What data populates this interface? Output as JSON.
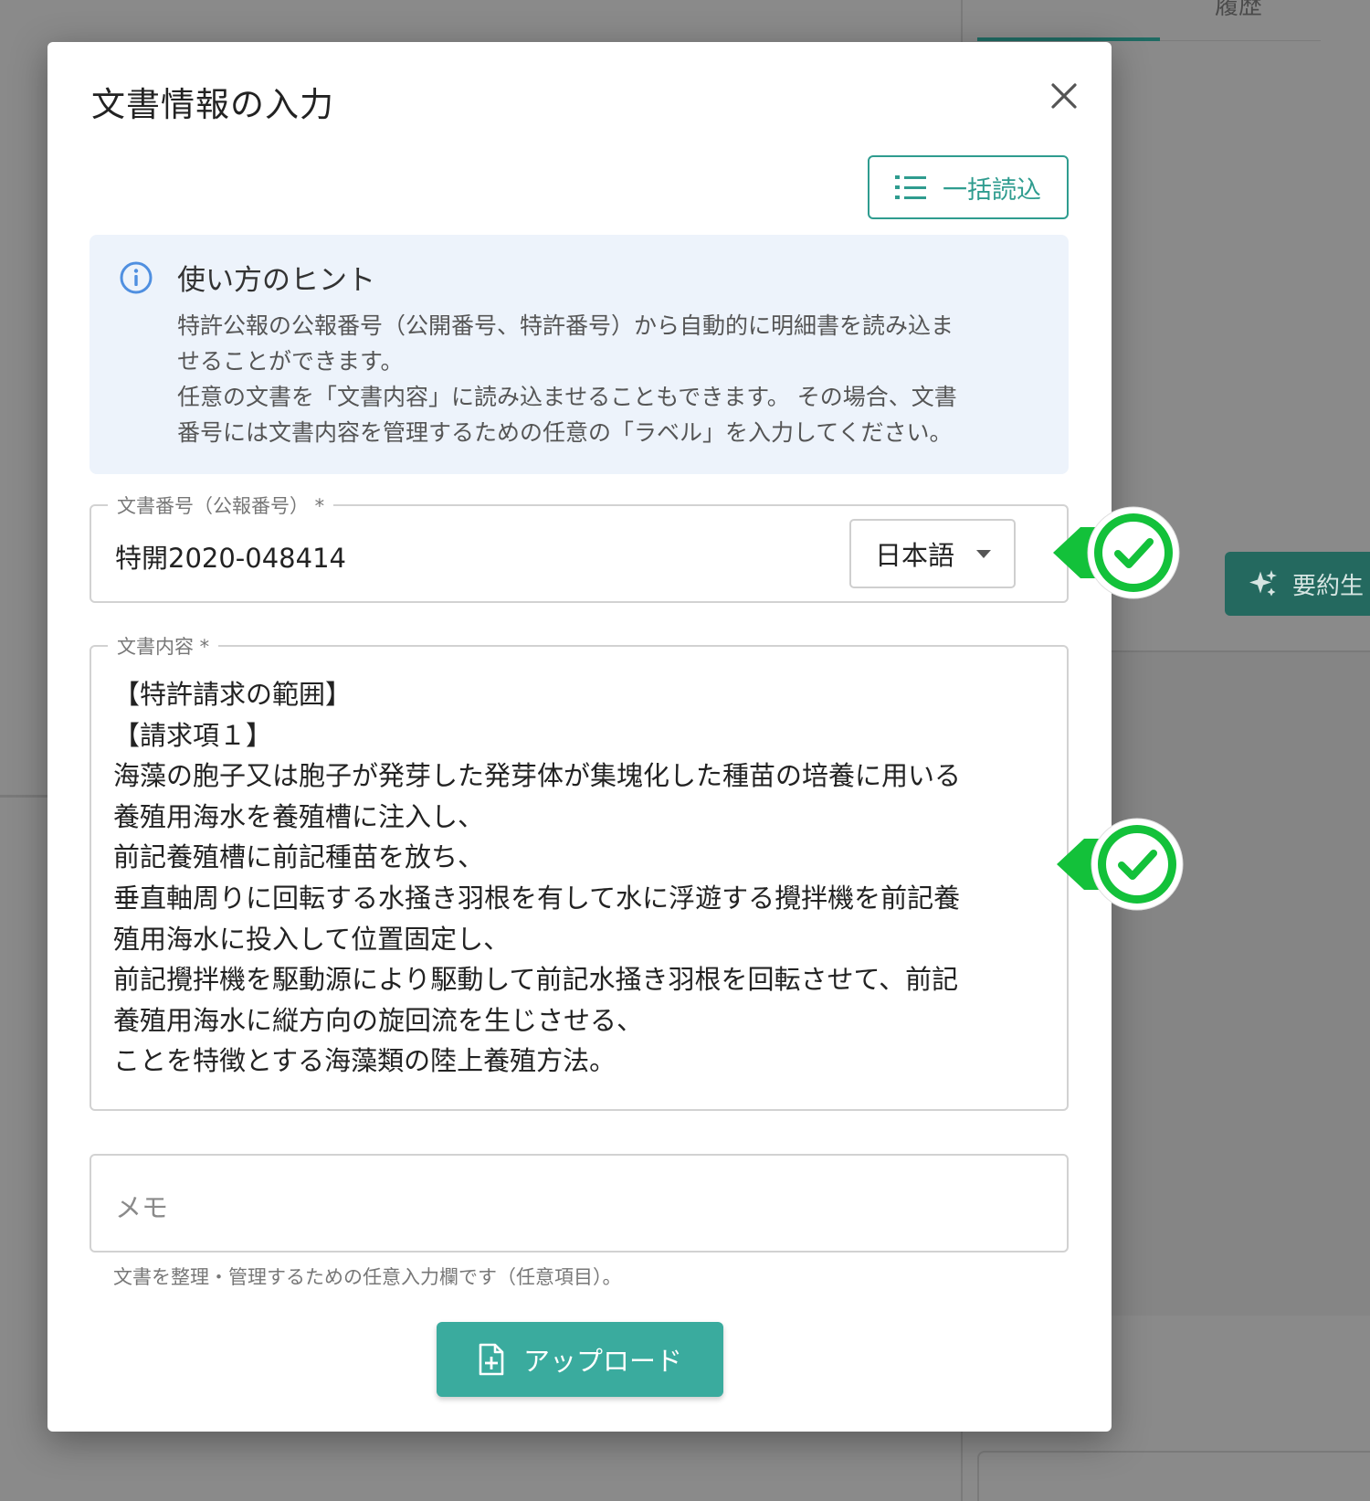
{
  "background": {
    "right_tab_label": "履歴",
    "summary_button_label": "要約生"
  },
  "modal": {
    "title": "文書情報の入力",
    "bulk_button_label": "一括読込",
    "hint": {
      "title": "使い方のヒント",
      "lines": [
        "特許公報の公報番号（公開番号、特許番号）から自動的に明細書を読み込ま",
        "せることができます。",
        "任意の文書を「文書内容」に読み込ませることもできます。 その場合、文書",
        "番号には文書内容を管理するための任意の「ラベル」を入力してください。"
      ]
    },
    "doc_number": {
      "label": "文書番号（公報番号） *",
      "value": "特開2020-048414",
      "language": "日本語"
    },
    "doc_content": {
      "label": "文書内容 *",
      "value": "【特許請求の範囲】\n【請求項１】\n海藻の胞子又は胞子が発芽した発芽体が集塊化した種苗の培養に用いる\n養殖用海水を養殖槽に注入し、\n前記養殖槽に前記種苗を放ち、\n垂直軸周りに回転する水掻き羽根を有して水に浮遊する攪拌機を前記養\n殖用海水に投入して位置固定し、\n前記攪拌機を駆動源により駆動して前記水掻き羽根を回転させて、前記\n養殖用海水に縦方向の旋回流を生じさせる、\nことを特徴とする海藻類の陸上養殖方法。"
    },
    "memo": {
      "placeholder": "メモ",
      "helper": "文書を整理・管理するための任意入力欄です（任意項目）。"
    },
    "upload_button_label": "アップロード"
  },
  "colors": {
    "accent": "#3aab9e",
    "check_green": "#13c13a"
  }
}
